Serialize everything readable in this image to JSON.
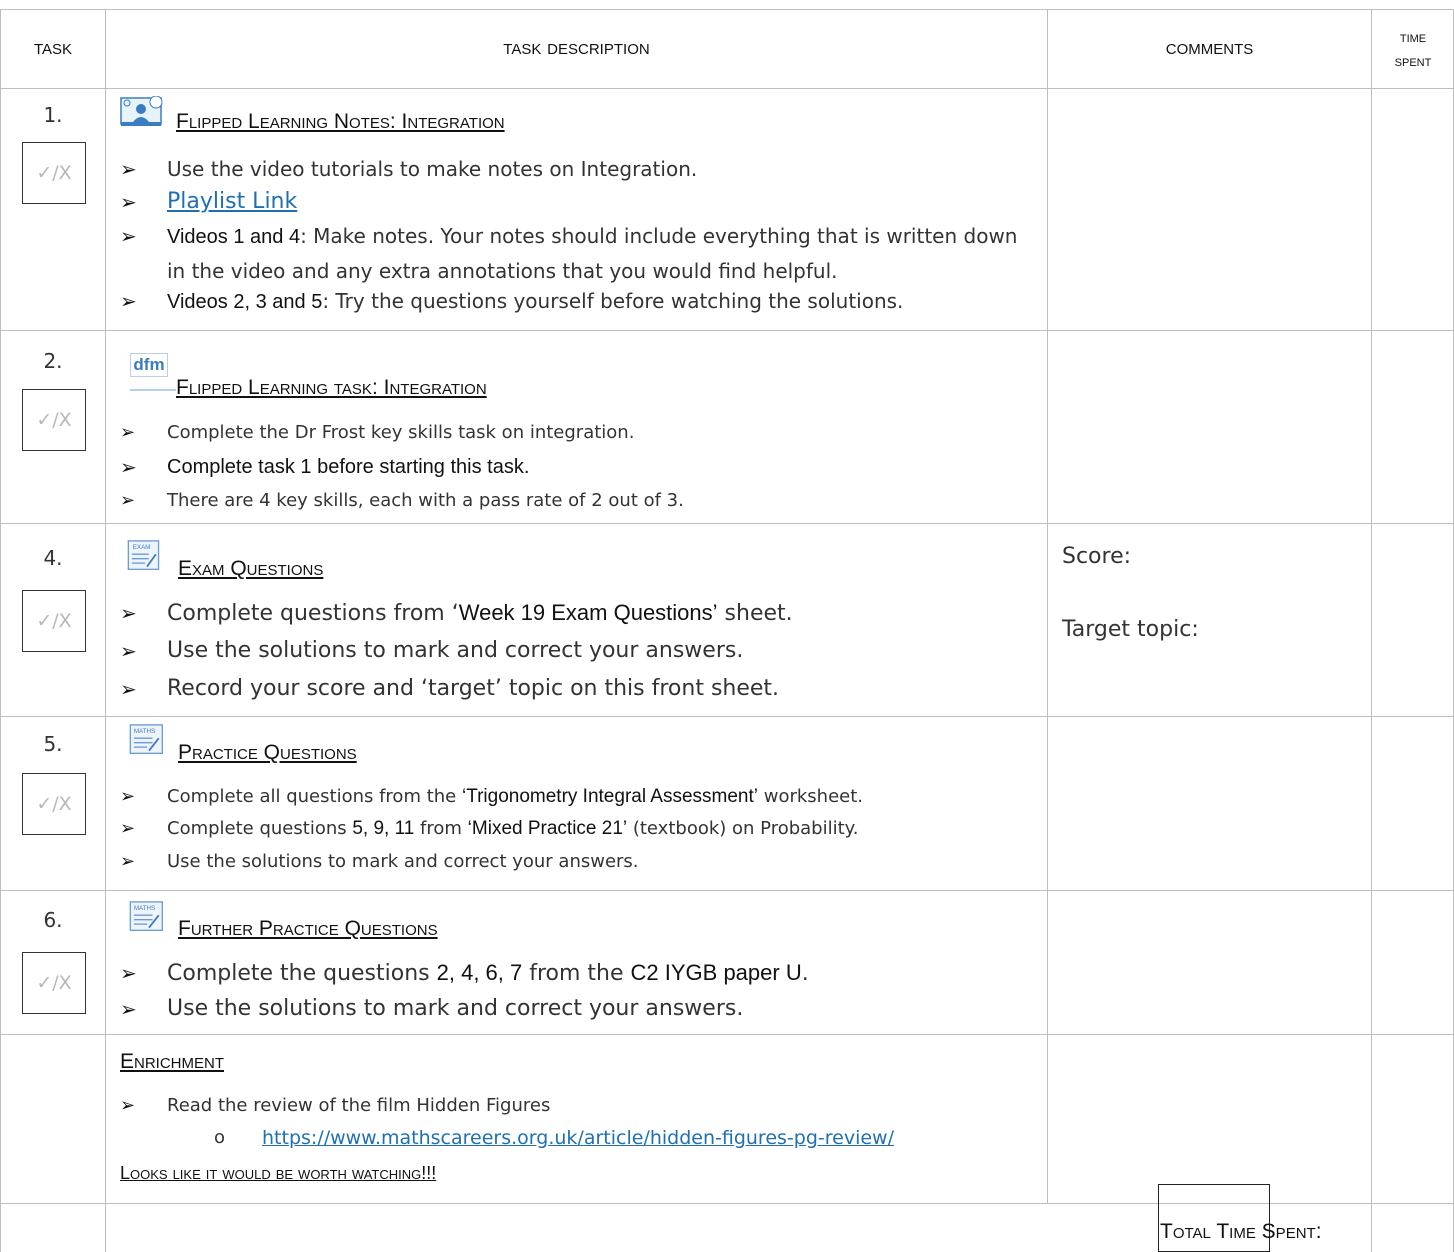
{
  "header": {
    "task": "Task",
    "description": "Task Description",
    "comments": "Comments",
    "time_spent_1": "Time",
    "time_spent_2": "Spent"
  },
  "checkbox_label": "✓/X",
  "bullet_glyph": "➢",
  "rows": [
    {
      "number": "1.",
      "icon": "video-notes-icon",
      "title": "Flipped Learning Notes: Integration",
      "b1": "Use the video tutorials to make notes on Integration.",
      "b2_link": "Playlist Link",
      "b3_bold": "Videos 1 and 4",
      "b3_text": ": Make notes. Your notes should include everything that is written down in the video and any extra annotations that you would find helpful.",
      "b4_bold": "Videos 2, 3 and 5",
      "b4_text": ": Try the questions yourself before watching the solutions."
    },
    {
      "number": "2.",
      "icon": "dfm-logo-icon",
      "icon_text": "dfm",
      "title": "Flipped Learning task: Integration",
      "b1": "Complete the Dr Frost key skills task on integration.",
      "b2_bold": "Complete task 1 before starting this task.",
      "b3": "There are 4 key skills, each with a pass rate of 2 out of 3."
    },
    {
      "number": "4.",
      "icon": "exam-paper-icon",
      "icon_text": "EXAM",
      "title": "Exam Questions",
      "b1_pre": "Complete questions from ‘",
      "b1_bold": "Week 19 Exam Questions’",
      "b1_post": " sheet.",
      "b2": "Use the solutions to mark and correct your answers.",
      "b3": "Record your score and ‘target’ topic on this front sheet.",
      "comment_score": "Score:",
      "comment_target": "Target topic:"
    },
    {
      "number": "5.",
      "icon": "maths-paper-icon",
      "icon_text": "MATHS",
      "title": "Practice Questions",
      "b1_pre": "Complete all questions from the ",
      "b1_bold": "‘Trigonometry Integral Assessment’",
      "b1_post": " worksheet.",
      "b2_pre": "Complete questions ",
      "b2_bold1": "5, 9, 11",
      "b2_mid": " from ",
      "b2_bold2": "‘Mixed Practice 21’",
      "b2_post": " (textbook) on Probability.",
      "b3": "Use the solutions to mark and correct your answers."
    },
    {
      "number": "6.",
      "icon": "maths-paper-icon",
      "icon_text": "MATHS",
      "title": "Further Practice Questions",
      "b1_pre": "Complete the questions ",
      "b1_bold1": "2, 4, 6, 7",
      "b1_mid": " from the ",
      "b1_bold2": "C2 IYGB paper U",
      "b1_post": ".",
      "b2": "Use the solutions to mark and correct your answers."
    }
  ],
  "enrichment": {
    "title": "Enrichment",
    "b1": "Read the review of the film Hidden Figures",
    "sub_bullet": "o",
    "link": "https://www.mathscareers.org.uk/article/hidden-figures-pg-review/",
    "footer": "Looks like it would be worth watching!!!"
  },
  "total": "Total Time Spent:"
}
